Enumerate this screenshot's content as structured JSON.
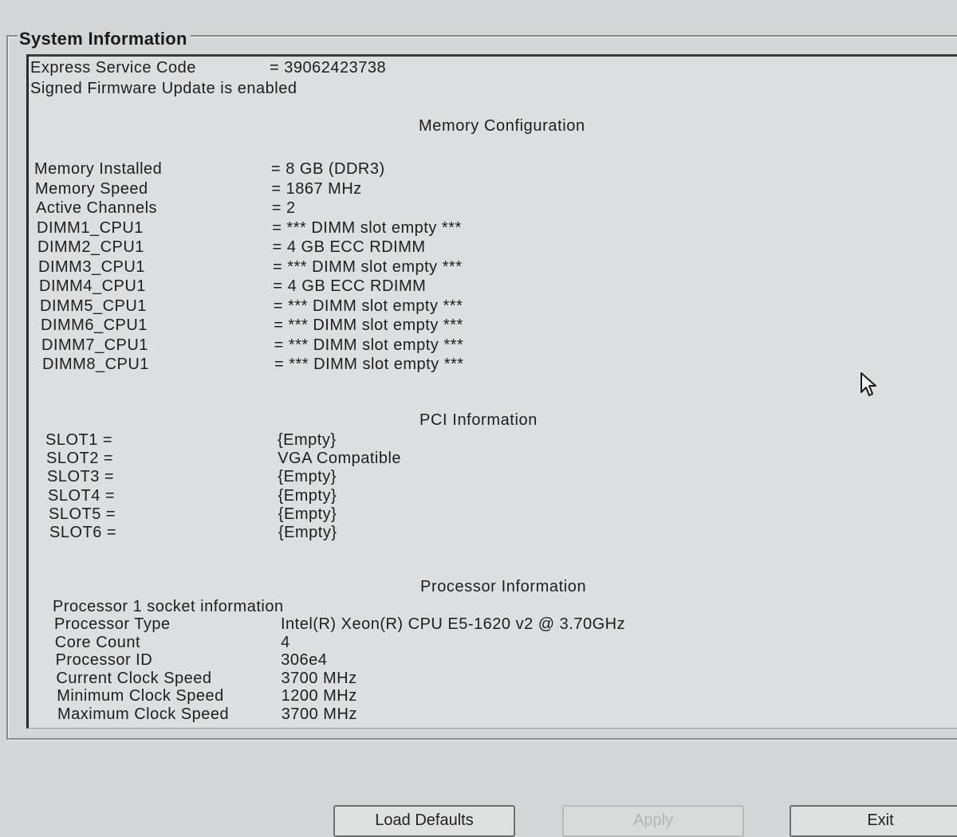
{
  "page": {
    "title": "System Information"
  },
  "header": {
    "express_service_code_label": "Express Service Code",
    "express_service_code_value": "= 39062423738",
    "firmware_status": "Signed Firmware Update is enabled"
  },
  "memory": {
    "heading": "Memory Configuration",
    "rows": [
      {
        "label": "Memory Installed",
        "value": "= 8 GB (DDR3)"
      },
      {
        "label": "Memory Speed",
        "value": "= 1867 MHz"
      },
      {
        "label": "Active Channels",
        "value": "= 2"
      },
      {
        "label": "DIMM1_CPU1",
        "value": "= *** DIMM slot empty ***"
      },
      {
        "label": "DIMM2_CPU1",
        "value": "= 4 GB ECC RDIMM"
      },
      {
        "label": "DIMM3_CPU1",
        "value": "= *** DIMM slot empty ***"
      },
      {
        "label": "DIMM4_CPU1",
        "value": "= 4 GB ECC RDIMM"
      },
      {
        "label": "DIMM5_CPU1",
        "value": "= *** DIMM slot empty ***"
      },
      {
        "label": "DIMM6_CPU1",
        "value": "= *** DIMM slot empty ***"
      },
      {
        "label": "DIMM7_CPU1",
        "value": "= *** DIMM slot empty ***"
      },
      {
        "label": "DIMM8_CPU1",
        "value": "= *** DIMM slot empty ***"
      }
    ]
  },
  "pci": {
    "heading": "PCI Information",
    "rows": [
      {
        "label": "SLOT1 =",
        "value": "{Empty}"
      },
      {
        "label": "SLOT2 =",
        "value": "VGA Compatible"
      },
      {
        "label": "SLOT3 =",
        "value": "{Empty}"
      },
      {
        "label": "SLOT4 =",
        "value": "{Empty}"
      },
      {
        "label": "SLOT5 =",
        "value": "{Empty}"
      },
      {
        "label": "SLOT6 =",
        "value": "{Empty}"
      }
    ]
  },
  "processor": {
    "heading": "Processor Information",
    "socket_label": "Processor 1 socket information",
    "rows": [
      {
        "label": "Processor Type",
        "value": "Intel(R) Xeon(R) CPU E5-1620 v2 @ 3.70GHz"
      },
      {
        "label": "Core Count",
        "value": "4"
      },
      {
        "label": "Processor ID",
        "value": "306e4"
      },
      {
        "label": "Current Clock Speed",
        "value": "3700 MHz"
      },
      {
        "label": "Minimum Clock Speed",
        "value": "1200 MHz"
      },
      {
        "label": "Maximum Clock Speed",
        "value": "3700 MHz"
      }
    ]
  },
  "buttons": {
    "load_defaults": "Load Defaults",
    "apply": "Apply",
    "exit": "Exit"
  }
}
